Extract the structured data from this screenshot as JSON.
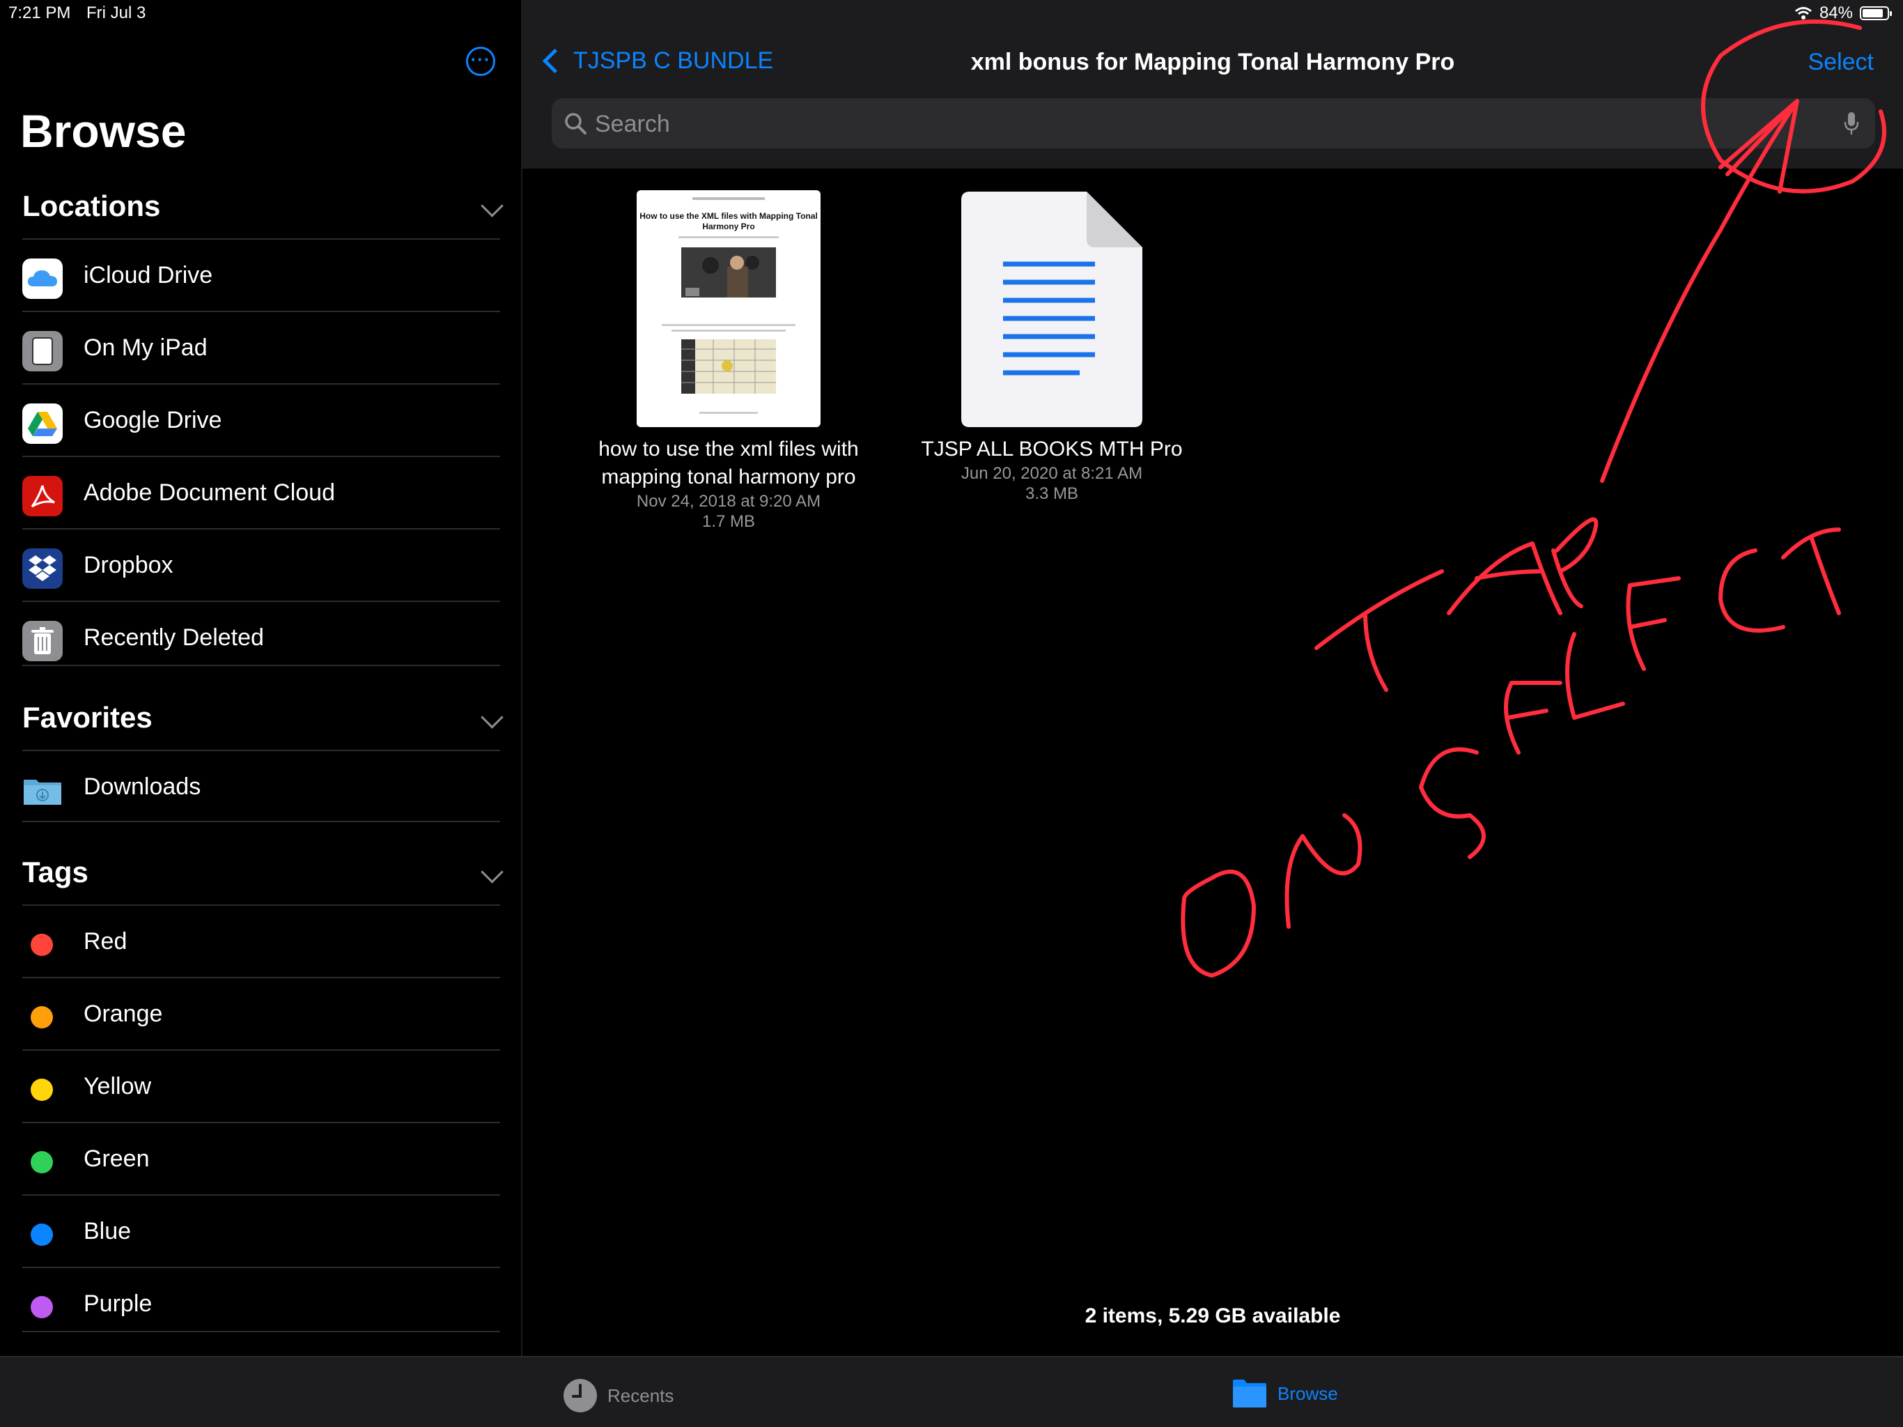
{
  "status": {
    "time": "7:21 PM",
    "date": "Fri Jul 3",
    "battery": "84%",
    "battery_level": 0.84
  },
  "sidebar": {
    "title": "Browse",
    "locations_header": "Locations",
    "locations": [
      {
        "label": "iCloud Drive",
        "icon": "icloud-icon"
      },
      {
        "label": "On My iPad",
        "icon": "ipad-icon"
      },
      {
        "label": "Google Drive",
        "icon": "google-drive-icon"
      },
      {
        "label": "Adobe Document Cloud",
        "icon": "adobe-icon"
      },
      {
        "label": "Dropbox",
        "icon": "dropbox-icon"
      },
      {
        "label": "Recently Deleted",
        "icon": "trash-icon"
      }
    ],
    "favorites_header": "Favorites",
    "favorites": [
      {
        "label": "Downloads",
        "icon": "downloads-folder-icon"
      }
    ],
    "tags_header": "Tags",
    "tags": [
      {
        "label": "Red",
        "color": "#ff453a"
      },
      {
        "label": "Orange",
        "color": "#ff9f0a"
      },
      {
        "label": "Yellow",
        "color": "#ffd60a"
      },
      {
        "label": "Green",
        "color": "#30d158"
      },
      {
        "label": "Blue",
        "color": "#0a84ff"
      },
      {
        "label": "Purple",
        "color": "#bf5af2"
      }
    ]
  },
  "nav": {
    "back_label": "TJSPB C BUNDLE",
    "title": "xml bonus for Mapping Tonal Harmony Pro",
    "select_label": "Select",
    "search_placeholder": "Search"
  },
  "files": [
    {
      "name_line1": "how to use the xml files with",
      "name_line2": "mapping tonal harmony pro",
      "date": "Nov 24, 2018 at 9:20 AM",
      "size": "1.7 MB",
      "thumb_title": "How to use the XML files with Mapping Tonal Harmony Pro"
    },
    {
      "name_line1": "TJSP ALL BOOKS MTH Pro",
      "date": "Jun 20, 2020 at 8:21 AM",
      "size": "3.3 MB"
    }
  ],
  "footer": {
    "count": "2 items, 5.29 GB available"
  },
  "tabbar": {
    "recents": "Recents",
    "browse": "Browse"
  },
  "colors": {
    "accent": "#0a84ff",
    "annotation": "#ff2d3d"
  }
}
